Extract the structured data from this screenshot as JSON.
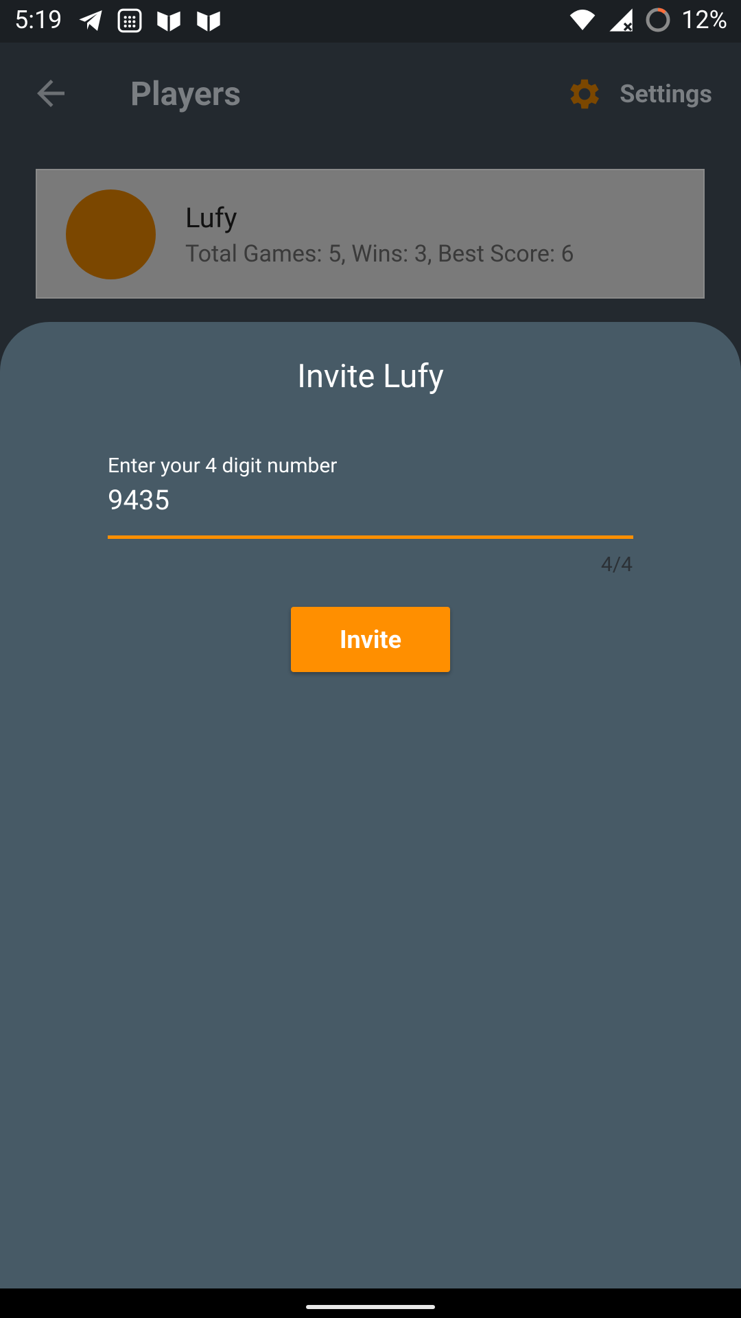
{
  "status_bar": {
    "time": "5:19",
    "battery": "12%",
    "left_icons": [
      "telegram-icon",
      "calculator-icon",
      "shield-icon",
      "shield-icon"
    ],
    "right_icons": [
      "wifi-icon",
      "signal-icon",
      "battery-ring-icon"
    ]
  },
  "appbar": {
    "title": "Players",
    "settings_label": "Settings",
    "accent_color": "#7b4700"
  },
  "player": {
    "name": "Lufy",
    "stats": "Total Games: 5, Wins: 3, Best Score: 6"
  },
  "invite_sheet": {
    "title": "Invite Lufy",
    "field_label": "Enter your 4 digit number",
    "field_value": "9435",
    "counter": "4/4",
    "button_label": "Invite",
    "accent_color": "#ff8f00",
    "background_color": "#475a66"
  }
}
